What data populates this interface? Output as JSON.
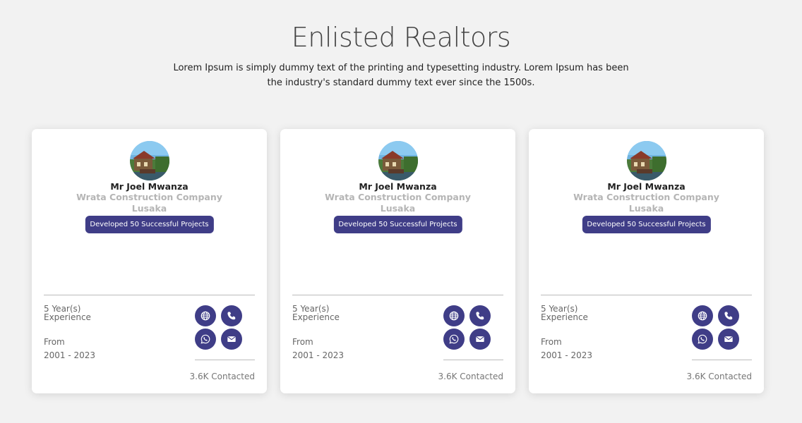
{
  "page": {
    "title": "Enlisted Realtors",
    "subtitle": "Lorem Ipsum is simply dummy text of the printing and typesetting industry. Lorem Ipsum has been the industry's standard dummy text ever since the 1500s."
  },
  "cards": [
    {
      "name": "Mr Joel Mwanza",
      "company": "Wrata Construction Company",
      "city": "Lusaka",
      "badge": "Developed 50 Successful Projects",
      "experience_value": "5 Year(s)",
      "experience_label": "Experience",
      "from_label": "From",
      "from_value": "2001 - 2023",
      "contacted": "3.6K Contacted"
    },
    {
      "name": "Mr Joel Mwanza",
      "company": "Wrata Construction Company",
      "city": "Lusaka",
      "badge": "Developed 50 Successful Projects",
      "experience_value": "5 Year(s)",
      "experience_label": "Experience",
      "from_label": "From",
      "from_value": "2001 - 2023",
      "contacted": "3.6K Contacted"
    },
    {
      "name": "Mr Joel Mwanza",
      "company": "Wrata Construction Company",
      "city": "Lusaka",
      "badge": "Developed 50 Successful Projects",
      "experience_value": "5 Year(s)",
      "experience_label": "Experience",
      "from_label": "From",
      "from_value": "2001 - 2023",
      "contacted": "3.6K Contacted"
    }
  ],
  "icons": [
    "globe-icon",
    "phone-icon",
    "whatsapp-icon",
    "envelope-icon"
  ],
  "colors": {
    "accent": "#3f3d87",
    "background": "#f2f2f2",
    "card": "#ffffff",
    "muted_text": "#b5b5b5"
  }
}
